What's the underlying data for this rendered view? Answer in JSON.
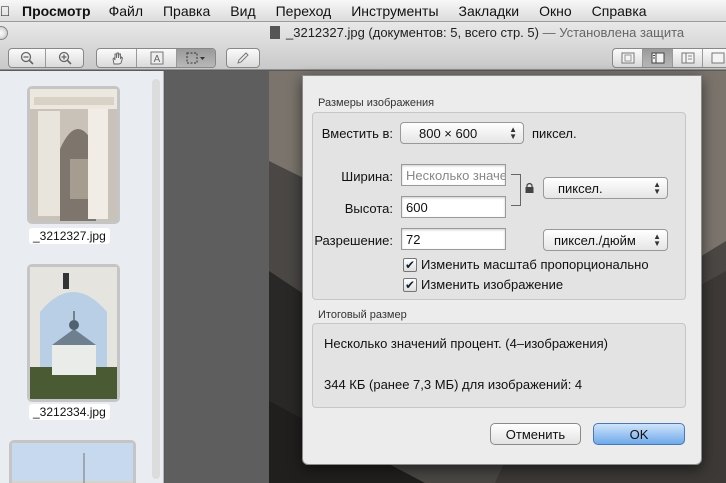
{
  "menubar": {
    "apple_icon": "apple-icon",
    "app_name": "Просмотр",
    "items": [
      "Файл",
      "Правка",
      "Вид",
      "Переход",
      "Инструменты",
      "Закладки",
      "Окно",
      "Справка"
    ]
  },
  "window": {
    "title": "_3212327.jpg (документов: 5, всего стр. 5)",
    "subtitle": " — Установлена защита"
  },
  "toolbar": {
    "zoom_icons": [
      "zoom-out-icon",
      "zoom-in-icon"
    ],
    "tool_icons": [
      "hand-icon",
      "text-select-icon",
      "rect-select-icon"
    ],
    "annotate_icon": "pencil-icon",
    "view_icons": [
      "single-view-icon",
      "sidebar-view-icon",
      "content-view-icon",
      "more-view-icon"
    ]
  },
  "sidebar": {
    "items": [
      {
        "label": "_3212327.jpg"
      },
      {
        "label": "_3212334.jpg"
      },
      {
        "label": ""
      }
    ]
  },
  "dialog": {
    "image_size_section": "Размеры изображения",
    "fit_label": "Вместить в:",
    "fit_value": "800 × 600",
    "fit_unit": "пиксел.",
    "width_label": "Ширина:",
    "width_placeholder": "Несколько значений",
    "height_label": "Высота:",
    "height_value": "600",
    "size_unit": "пиксел.",
    "resolution_label": "Разрешение:",
    "resolution_value": "72",
    "resolution_unit": "пиксел./дюйм",
    "scale_proportionally": "Изменить масштаб пропорционально",
    "resample_image": "Изменить изображение",
    "result_section": "Итоговый размер",
    "result_line1": "Несколько значений процент. (4–изображения)",
    "result_line2": "344 КБ (ранее 7,3 МБ) для изображений: 4",
    "cancel_label": "Отменить",
    "ok_label": "OK"
  },
  "colors": {
    "default_button": "#6ea9ea",
    "sheet_bg": "#ececec"
  }
}
